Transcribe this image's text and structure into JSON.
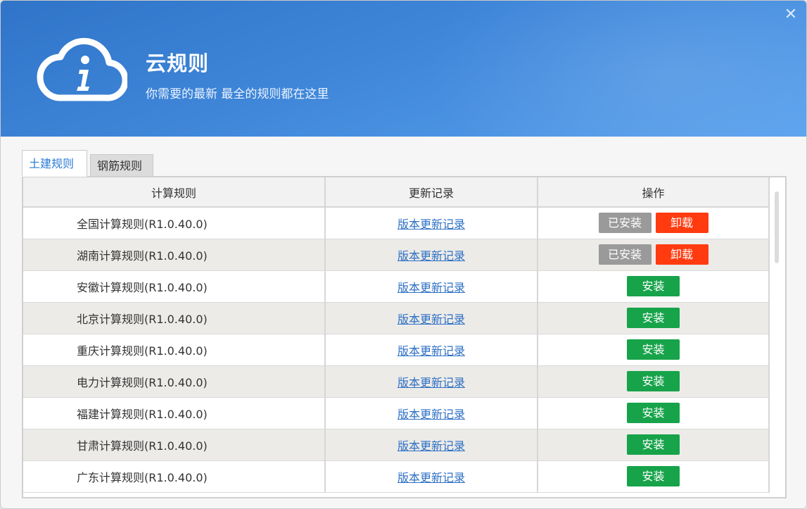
{
  "window": {
    "title": "云规则",
    "subtitle": "你需要的最新 最全的规则都在这里",
    "close_glyph": "✕"
  },
  "tabs": [
    {
      "label": "土建规则",
      "active": true
    },
    {
      "label": "钢筋规则",
      "active": false
    }
  ],
  "table": {
    "headers": [
      "计算规则",
      "更新记录",
      "操作"
    ],
    "rows": [
      {
        "name": "全国计算规则(R1.0.40.0)",
        "log": "版本更新记录",
        "installed": true
      },
      {
        "name": "湖南计算规则(R1.0.40.0)",
        "log": "版本更新记录",
        "installed": true
      },
      {
        "name": "安徽计算规则(R1.0.40.0)",
        "log": "版本更新记录",
        "installed": false
      },
      {
        "name": "北京计算规则(R1.0.40.0)",
        "log": "版本更新记录",
        "installed": false
      },
      {
        "name": "重庆计算规则(R1.0.40.0)",
        "log": "版本更新记录",
        "installed": false
      },
      {
        "name": "电力计算规则(R1.0.40.0)",
        "log": "版本更新记录",
        "installed": false
      },
      {
        "name": "福建计算规则(R1.0.40.0)",
        "log": "版本更新记录",
        "installed": false
      },
      {
        "name": "甘肃计算规则(R1.0.40.0)",
        "log": "版本更新记录",
        "installed": false
      },
      {
        "name": "广东计算规则(R1.0.40.0)",
        "log": "版本更新记录",
        "installed": false
      }
    ]
  },
  "labels": {
    "installed": "已安装",
    "uninstall": "卸载",
    "install": "安装"
  },
  "colors": {
    "header_blue": "#3f86d9",
    "uninstall_red": "#ff3b0f",
    "install_green": "#17a34a",
    "installed_gray": "#9a9a9a",
    "link_blue": "#2d6fc4"
  },
  "icons": {
    "logo": "cloud-info-icon",
    "close": "close-icon"
  }
}
